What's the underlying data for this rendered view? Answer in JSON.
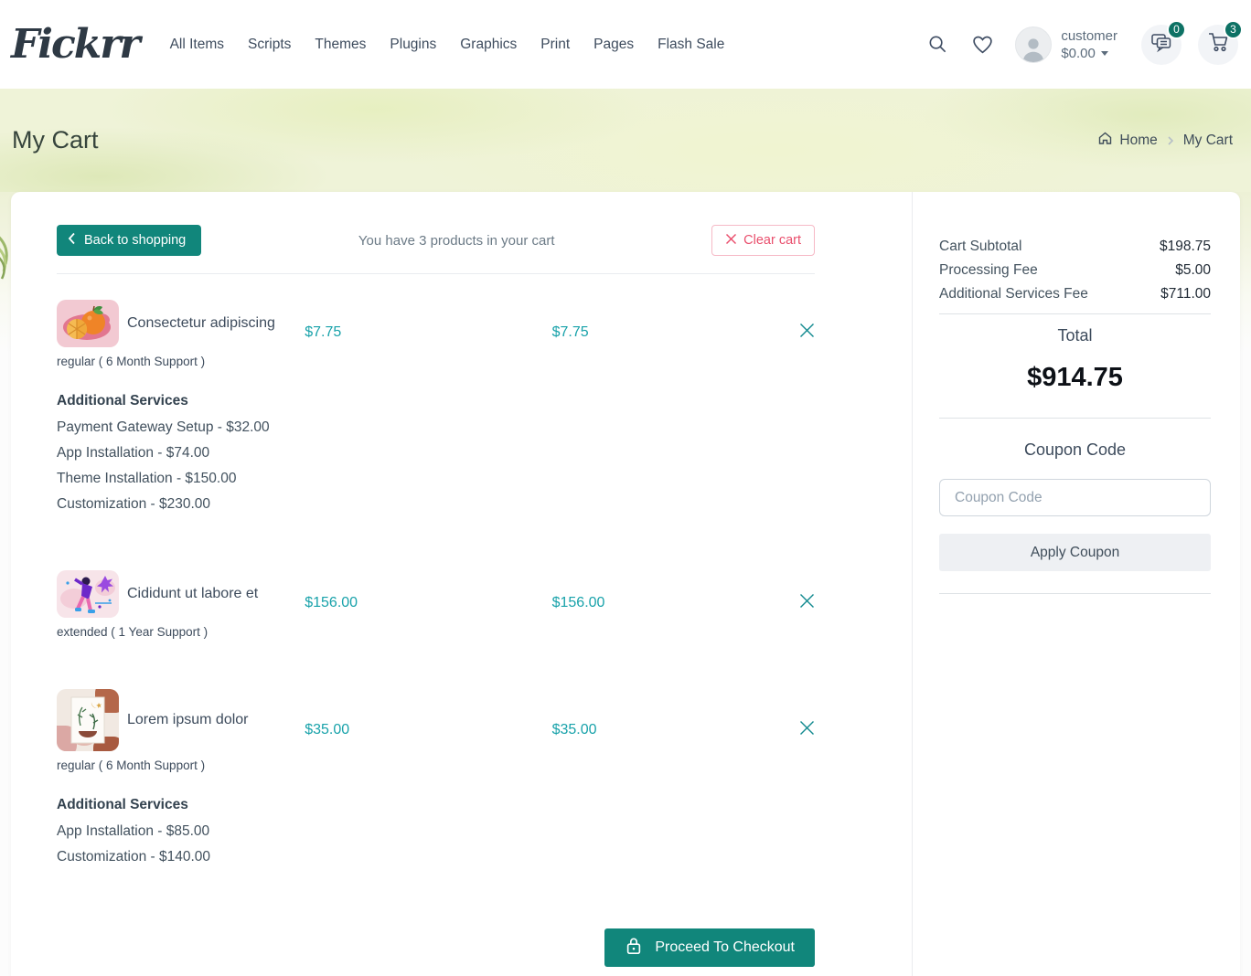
{
  "colors": {
    "accent_teal": "#11867b",
    "price_teal": "#18a2aa",
    "badge_teal": "#0e7265",
    "danger_pink": "#e94f6d",
    "banner_green": "#eff3d8"
  },
  "icons": {
    "search": "magnifier",
    "wishlist": "heart-outline",
    "account": "person-avatar",
    "messages": "chat-bubbles",
    "cart": "shopping-cart",
    "home": "house",
    "back": "chevron-left",
    "breadcrumb_separator": "chevron-right",
    "balance_caret": "caret-down",
    "clear": "x-cross",
    "remove_item": "x-cross",
    "checkout": "padlock"
  },
  "header": {
    "logo": "Fickrr",
    "nav": [
      "All Items",
      "Scripts",
      "Themes",
      "Plugins",
      "Graphics",
      "Print",
      "Pages",
      "Flash Sale"
    ],
    "account": {
      "name": "customer",
      "balance": "$0.00"
    },
    "messages_badge": "0",
    "cart_badge": "3"
  },
  "banner": {
    "title": "My Cart",
    "breadcrumb": {
      "home": "Home",
      "current": "My Cart"
    }
  },
  "cart": {
    "back_button": "Back to shopping",
    "count_text": "You have 3 products in your cart",
    "clear_button": "Clear cart",
    "items": [
      {
        "name": "Consectetur adipiscing",
        "license": "regular ( 6 Month Support )",
        "price": "$7.75",
        "subtotal": "$7.75",
        "services_title": "Additional Services",
        "services": [
          "Payment Gateway Setup - $32.00",
          "App Installation - $74.00",
          "Theme Installation - $150.00",
          "Customization - $230.00"
        ]
      },
      {
        "name": "Cididunt ut labore et",
        "license": "extended ( 1 Year Support )",
        "price": "$156.00",
        "subtotal": "$156.00"
      },
      {
        "name": "Lorem ipsum dolor",
        "license": "regular ( 6 Month Support )",
        "price": "$35.00",
        "subtotal": "$35.00",
        "services_title": "Additional Services",
        "services": [
          "App Installation - $85.00",
          "Customization - $140.00"
        ]
      }
    ],
    "checkout_button": "Proceed To Checkout"
  },
  "summary": {
    "rows": [
      {
        "label": "Cart Subtotal",
        "value": "$198.75"
      },
      {
        "label": "Processing Fee",
        "value": "$5.00"
      },
      {
        "label": "Additional Services Fee",
        "value": "$711.00"
      }
    ],
    "total_label": "Total",
    "total_value": "$914.75",
    "coupon_title": "Coupon Code",
    "coupon_placeholder": "Coupon Code",
    "apply_button": "Apply Coupon"
  }
}
